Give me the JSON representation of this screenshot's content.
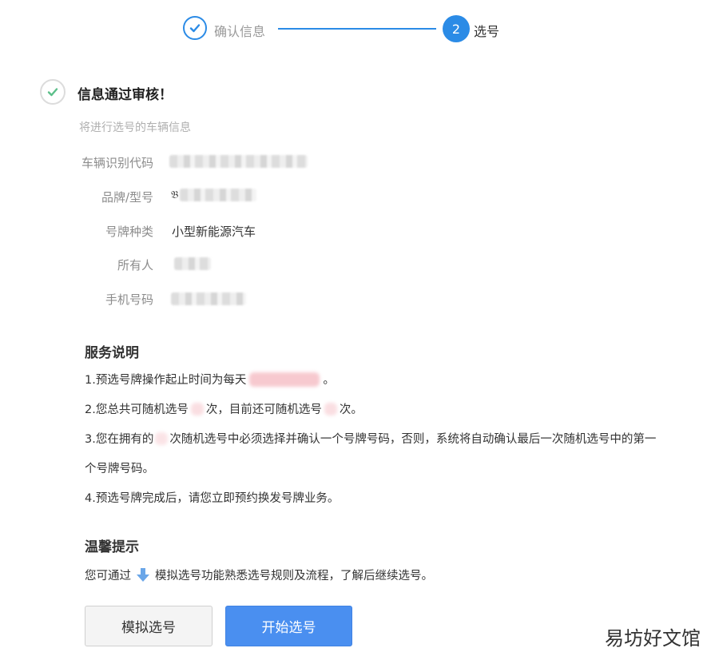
{
  "stepper": {
    "step1_label": "确认信息",
    "step2_number": "2",
    "step2_label": "选号"
  },
  "header": {
    "title": "信息通过审核！",
    "subtitle": "将进行选号的车辆信息"
  },
  "vehicle_info": {
    "vin_label": "车辆识别代码",
    "brand_label": "品牌/型号",
    "brand_prefix": "𝔅",
    "plate_type_label": "号牌种类",
    "plate_type_value": "小型新能源汽车",
    "owner_label": "所有人",
    "phone_label": "手机号码"
  },
  "service": {
    "title": "服务说明",
    "line1_a": "1.预选号牌操作起止时间为每天",
    "line1_b": "。",
    "line2_a": "2.您总共可随机选号",
    "line2_b": "次，目前还可随机选号",
    "line2_c": "次。",
    "line3_a": "3.您在拥有的",
    "line3_b": "次随机选号中必须选择并确认一个号牌号码，否则，系统将自动确认最后一次随机选号中的第一",
    "line3_c": "个号牌号码。",
    "line4": "4.预选号牌完成后，请您立即预约换发号牌业务。"
  },
  "tips": {
    "title": "温馨提示",
    "text_a": "您可通过",
    "text_b": "模拟选号功能熟悉选号规则及流程，了解后继续选号。"
  },
  "buttons": {
    "simulate": "模拟选号",
    "start": "开始选号"
  },
  "watermark": "易坊好文馆",
  "colors": {
    "accent": "#2b8be6",
    "success_check": "#5cbf8a",
    "primary_button": "#4a8ff0"
  }
}
